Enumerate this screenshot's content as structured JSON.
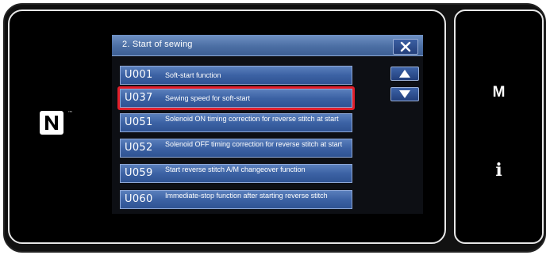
{
  "dialog": {
    "title": "2. Start of sewing",
    "close_icon": "close-icon"
  },
  "items": [
    {
      "code": "U001",
      "label": "Soft-start function",
      "selected": false
    },
    {
      "code": "U037",
      "label": "Sewing speed for soft-start",
      "selected": true
    },
    {
      "code": "U051",
      "label": "Solenoid ON timing correction for reverse stitch at start",
      "selected": false
    },
    {
      "code": "U052",
      "label": "Solenoid OFF timing correction for reverse stitch at start",
      "selected": false
    },
    {
      "code": "U059",
      "label": "Start reverse stitch A/M changeover function",
      "selected": false
    },
    {
      "code": "U060",
      "label": "Immediate-stop function after starting reverse stitch",
      "selected": false
    }
  ],
  "scroll": {
    "up_icon": "triangle-up-icon",
    "down_icon": "triangle-down-icon"
  },
  "side": {
    "m_label": "M",
    "info_label": "i"
  },
  "nfc": {
    "icon": "nfc-n-mark-icon",
    "tm": "™"
  },
  "colors": {
    "title_bar": "#4c6fa4",
    "item_bg": "#3c62a4",
    "selection": "#e01f2b",
    "screen_bg": "#000000"
  }
}
